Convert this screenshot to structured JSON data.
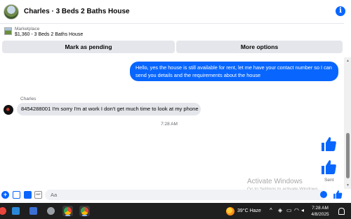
{
  "header": {
    "title": "Charles · 3 Beds 2 Baths House"
  },
  "marketplace": {
    "label": "Marketplace",
    "listing": "$1,360 - 3 Beds 2 Baths House"
  },
  "actions": {
    "pending_label": "Mark as pending",
    "more_label": "More options"
  },
  "messages": {
    "outgoing": "Hello, yes the house is still available for rent, let me have your contact number so I can send you details and the requirements about the house",
    "sender_name": "Charles",
    "incoming": "8454288001 I'm sorry I'm at work I don't get much time to look at my phone",
    "timestamp": "7:28 AM",
    "status": "Sent"
  },
  "composer": {
    "placeholder": "Aa"
  },
  "watermark": {
    "title": "Activate Windows",
    "subtitle": "Go to Settings to activate Windows."
  },
  "taskbar": {
    "weather": "39°C  Haze",
    "time": "7:28 AM",
    "date": "4/8/2025",
    "apps": [
      "file-explorer-icon",
      "terminal-icon",
      "browser-icon",
      "chrome-icon",
      "chrome-icon"
    ]
  },
  "colors": {
    "accent": "#0866ff",
    "bubble_in": "#e4e6eb",
    "taskbar": "#1f1f1f"
  }
}
